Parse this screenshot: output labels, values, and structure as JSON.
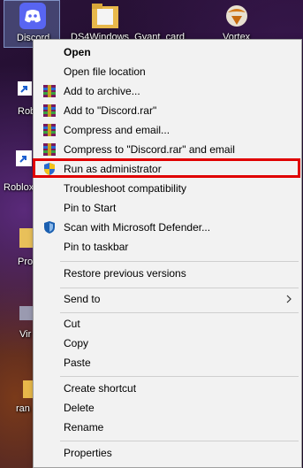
{
  "desktop": {
    "icons": [
      {
        "label": "Discord"
      },
      {
        "label": "DS4Windows_Gyant_card"
      },
      {
        "label": "Vortex"
      },
      {
        "label": "Robl Stu"
      },
      {
        "label": "Roblox"
      },
      {
        "label": "Proj"
      },
      {
        "label": "Vir Conte"
      },
      {
        "label": "ran"
      }
    ]
  },
  "menu": {
    "items": [
      {
        "label": "Open",
        "icon": ""
      },
      {
        "label": "Open file location",
        "icon": ""
      },
      {
        "label": "Add to archive...",
        "icon": "winrar-icon"
      },
      {
        "label": "Add to \"Discord.rar\"",
        "icon": "winrar-icon"
      },
      {
        "label": "Compress and email...",
        "icon": "winrar-icon"
      },
      {
        "label": "Compress to \"Discord.rar\" and email",
        "icon": "winrar-icon"
      },
      {
        "label": "Run as administrator",
        "icon": "uac-shield-icon"
      },
      {
        "label": "Troubleshoot compatibility",
        "icon": ""
      },
      {
        "label": "Pin to Start",
        "icon": ""
      },
      {
        "label": "Scan with Microsoft Defender...",
        "icon": "defender-icon"
      },
      {
        "label": "Pin to taskbar",
        "icon": ""
      },
      {
        "label": "Restore previous versions",
        "icon": ""
      },
      {
        "label": "Send to",
        "icon": "chevron-right-icon"
      },
      {
        "label": "Cut",
        "icon": ""
      },
      {
        "label": "Copy",
        "icon": ""
      },
      {
        "label": "Paste",
        "icon": ""
      },
      {
        "label": "Create shortcut",
        "icon": ""
      },
      {
        "label": "Delete",
        "icon": ""
      },
      {
        "label": "Rename",
        "icon": ""
      },
      {
        "label": "Properties",
        "icon": ""
      }
    ],
    "highlighted_item": "Run as administrator",
    "highlight_color": "#e00000"
  }
}
